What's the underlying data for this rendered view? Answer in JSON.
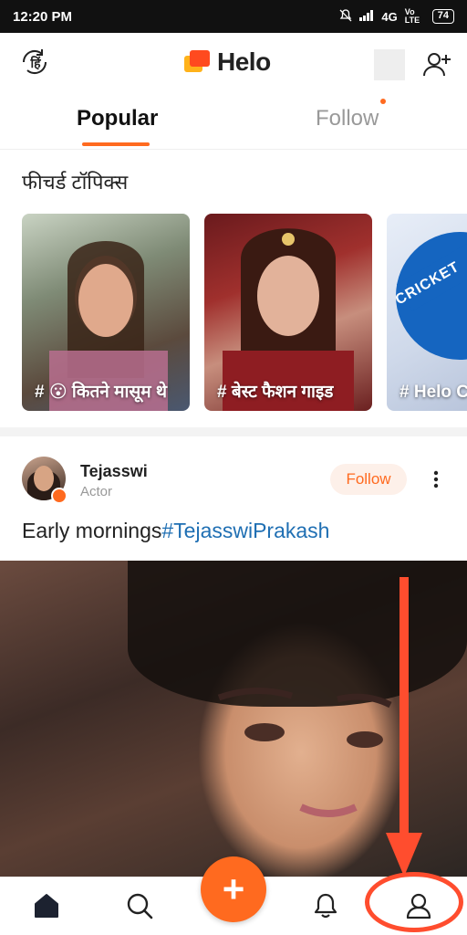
{
  "status_bar": {
    "time": "12:20 PM",
    "network": "4G",
    "volte": "Vo LTE",
    "battery": "74"
  },
  "app_bar": {
    "language_label": "हिं",
    "logo_text": "Helo",
    "icons": [
      "language-toggle-icon",
      "helo-logo-icon",
      "add-user-icon"
    ]
  },
  "tabs": [
    {
      "label": "Popular",
      "active": true
    },
    {
      "label": "Follow",
      "active": false
    }
  ],
  "featured": {
    "title": "फीचर्ड टॉपिक्स",
    "cards": [
      {
        "label": "# 😮 कितने मासूम थे"
      },
      {
        "label": "# बेस्ट फैशन गाइड"
      },
      {
        "label": "# Helo Contest"
      }
    ],
    "card3_badge": "CRICKET"
  },
  "post": {
    "username": "Tejasswi",
    "subtitle": "Actor",
    "follow_label": "Follow",
    "caption_text": "Early mornings",
    "caption_hashtag": "#TejasswiPrakash"
  },
  "bottom_nav": {
    "create_label": "+",
    "items": [
      "home-icon",
      "search-icon",
      "create-button",
      "bell-icon",
      "profile-icon"
    ]
  },
  "colors": {
    "accent": "#ff6a1f",
    "hashtag": "#1f6fb3",
    "annotation": "#ff4d2e"
  }
}
